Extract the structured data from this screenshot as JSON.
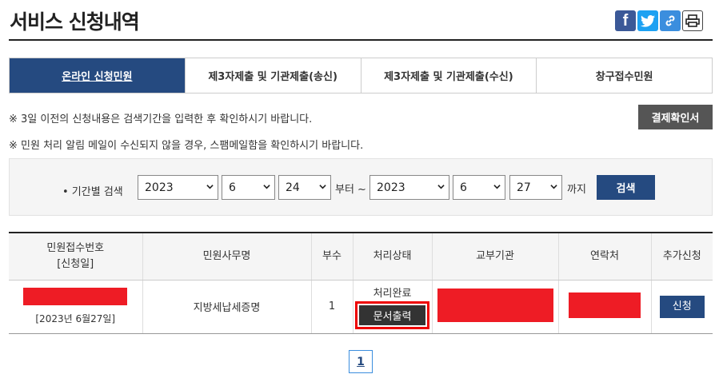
{
  "header": {
    "title": "서비스 신청내역",
    "share_icons": [
      "facebook-icon",
      "twitter-icon",
      "link-icon",
      "print-icon"
    ]
  },
  "tabs": [
    {
      "label": "온라인 신청민원",
      "active": true
    },
    {
      "label": "제3자제출 및 기관제출(송신)",
      "active": false
    },
    {
      "label": "제3자제출 및 기관제출(수신)",
      "active": false
    },
    {
      "label": "창구접수민원",
      "active": false
    }
  ],
  "notices": [
    "※ 3일 이전의 신청내용은 검색기간을 입력한 후 확인하시기 바랍니다.",
    "※ 민원 처리 알림 메일이 수신되지 않을 경우, 스팸메일함을 확인하시기 바랍니다."
  ],
  "confirm_button": "결제확인서",
  "search": {
    "label": "• 기간별 검색",
    "from_year": "2023",
    "from_month": "6",
    "from_day": "24",
    "from_suffix": "부터 ~",
    "to_year": "2023",
    "to_month": "6",
    "to_day": "27",
    "to_suffix": "까지",
    "button": "검색"
  },
  "table": {
    "headers": {
      "receipt_line1": "민원접수번호",
      "receipt_line2": "[신청일]",
      "service_name": "민원사무명",
      "copies": "부수",
      "status": "처리상태",
      "issuing_agency": "교부기관",
      "contact": "연락처",
      "additional": "추가신청"
    },
    "rows": [
      {
        "date": "[2023년 6월27일]",
        "service_name": "지방세납세증명",
        "copies": "1",
        "status": "처리완료",
        "print_button": "문서출력",
        "apply_button": "신청"
      }
    ]
  },
  "pagination": {
    "current": "1"
  },
  "colors": {
    "primary": "#254a80",
    "redaction": "#ee1c25",
    "highlight": "#e00000"
  }
}
